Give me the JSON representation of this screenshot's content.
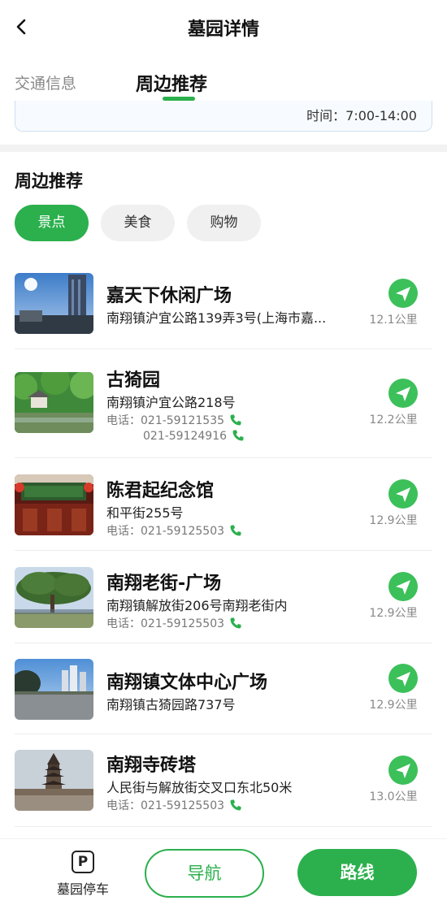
{
  "header": {
    "title": "墓园详情"
  },
  "tabs": [
    {
      "label": "交通信息"
    },
    {
      "label": "周边推荐"
    }
  ],
  "info_card": {
    "time": "时间：7:00-14:00"
  },
  "section": {
    "title": "周边推荐"
  },
  "categories": [
    {
      "label": "景点",
      "active": true
    },
    {
      "label": "美食",
      "active": false
    },
    {
      "label": "购物",
      "active": false
    }
  ],
  "places": [
    {
      "name": "嘉天下休闲广场",
      "address": "南翔镇沪宜公路139弄3号(上海市嘉...",
      "phones": [],
      "distance": "12.1公里"
    },
    {
      "name": "古猗园",
      "address": "南翔镇沪宜公路218号",
      "phones": [
        "电话：021-59121535",
        "021-59124916"
      ],
      "distance": "12.2公里"
    },
    {
      "name": "陈君起纪念馆",
      "address": "和平街255号",
      "phones": [
        "电话：021-59125503"
      ],
      "distance": "12.9公里"
    },
    {
      "name": "南翔老街-广场",
      "address": "南翔镇解放街206号南翔老街内",
      "phones": [
        "电话：021-59125503"
      ],
      "distance": "12.9公里"
    },
    {
      "name": "南翔镇文体中心广场",
      "address": "南翔镇古猗园路737号",
      "phones": [],
      "distance": "12.9公里"
    },
    {
      "name": "南翔寺砖塔",
      "address": "人民街与解放街交叉口东北50米",
      "phones": [
        "电话：021-59125503"
      ],
      "distance": "13.0公里"
    }
  ],
  "bottom": {
    "parking_label": "墓园停车",
    "parking_icon": "P",
    "navigate_label": "导航",
    "route_label": "路线"
  },
  "colors": {
    "accent": "#2bb04d"
  }
}
